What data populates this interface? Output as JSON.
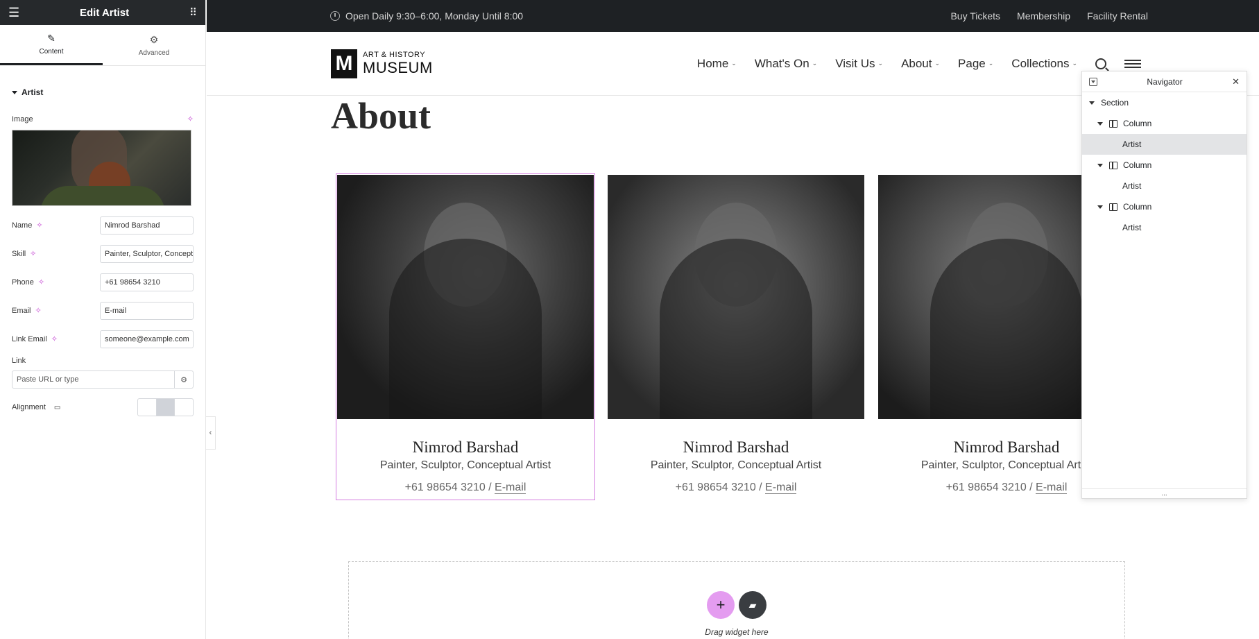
{
  "panel": {
    "title": "Edit Artist",
    "tabs": [
      {
        "label": "Content",
        "icon": "pencil-icon"
      },
      {
        "label": "Advanced",
        "icon": "gear-icon"
      }
    ],
    "section_title": "Artist",
    "image_label": "Image",
    "fields": [
      {
        "label": "Name",
        "value": "Nimrod Barshad"
      },
      {
        "label": "Skill",
        "value": "Painter, Sculptor, Conceptual Artist"
      },
      {
        "label": "Phone",
        "value": "+61 98654 3210"
      },
      {
        "label": "Email",
        "value": "E-mail"
      },
      {
        "label": "Link Email",
        "value": "someone@example.com"
      }
    ],
    "link_label": "Link",
    "link_placeholder": "Paste URL or type",
    "alignment_label": "Alignment"
  },
  "site": {
    "hours": "Open Daily 9:30–6:00, Monday Until 8:00",
    "top_links": [
      "Buy Tickets",
      "Membership",
      "Facility Rental"
    ],
    "logo_small": "ART & HISTORY",
    "logo_big": "MUSEUM",
    "logo_mark": "M",
    "nav": [
      "Home",
      "What's On",
      "Visit Us",
      "About",
      "Page",
      "Collections"
    ],
    "page_title": "About",
    "artists": [
      {
        "name": "Nimrod Barshad",
        "skill": "Painter, Sculptor, Conceptual Artist",
        "phone": "+61 98654 3210 / ",
        "email": "E-mail"
      },
      {
        "name": "Nimrod Barshad",
        "skill": "Painter, Sculptor, Conceptual Artist",
        "phone": "+61 98654 3210 / ",
        "email": "E-mail"
      },
      {
        "name": "Nimrod Barshad",
        "skill": "Painter, Sculptor, Conceptual Artist",
        "phone": "+61 98654 3210 / ",
        "email": "E-mail"
      }
    ],
    "dropzone_label": "Drag widget here"
  },
  "navigator": {
    "title": "Navigator",
    "tree": [
      {
        "label": "Section",
        "level": 0,
        "caret": true,
        "icon": false,
        "selected": false
      },
      {
        "label": "Column",
        "level": 1,
        "caret": true,
        "icon": true,
        "selected": false
      },
      {
        "label": "Artist",
        "level": 2,
        "caret": false,
        "icon": false,
        "selected": true
      },
      {
        "label": "Column",
        "level": 1,
        "caret": true,
        "icon": true,
        "selected": false
      },
      {
        "label": "Artist",
        "level": 2,
        "caret": false,
        "icon": false,
        "selected": false
      },
      {
        "label": "Column",
        "level": 1,
        "caret": true,
        "icon": true,
        "selected": false
      },
      {
        "label": "Artist",
        "level": 2,
        "caret": false,
        "icon": false,
        "selected": false
      }
    ],
    "footer": "..."
  },
  "colors": {
    "accent": "#d47ce0",
    "dark": "#1e2124"
  }
}
